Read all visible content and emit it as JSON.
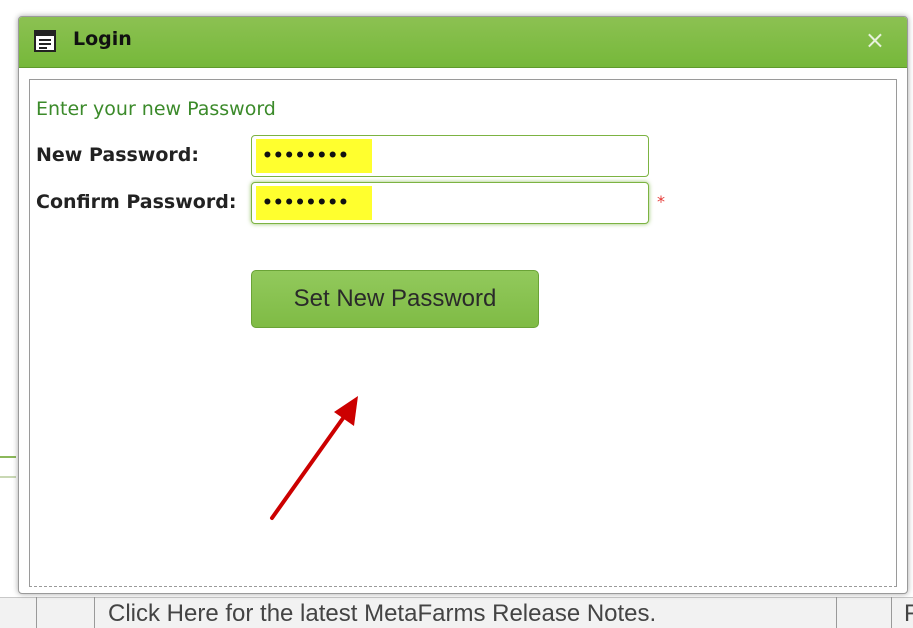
{
  "dialog": {
    "title": "Login",
    "close_symbol": "×",
    "title_icon": "window-icon",
    "accent_color": "#7ab93f"
  },
  "form": {
    "prompt": "Enter your new Password",
    "new_password_label": "New Password:",
    "new_password_value": "••••••••",
    "confirm_password_label": "Confirm Password:",
    "confirm_password_value": "••••••••",
    "required_marker": "*",
    "submit_label": "Set New Password"
  },
  "background": {
    "release_notes_link": "Click Here for the latest MetaFarms Release Notes.",
    "trailing_text": "F"
  },
  "annotation": {
    "arrow_color": "#cc0000"
  }
}
